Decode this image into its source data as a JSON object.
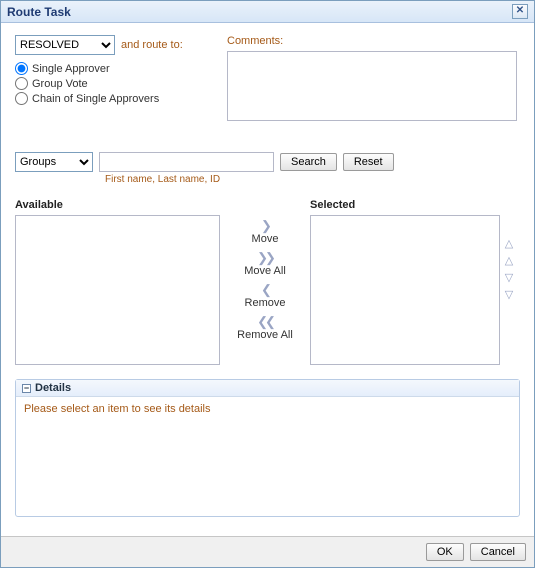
{
  "title": "Route Task",
  "status": {
    "options": [
      "RESOLVED"
    ],
    "selected": "RESOLVED"
  },
  "route_to_label": "and route to:",
  "route_type": {
    "single": "Single Approver",
    "group": "Group Vote",
    "chain": "Chain of Single Approvers",
    "selected": "single"
  },
  "comments_label": "Comments:",
  "comments_value": "",
  "scope": {
    "options": [
      "Groups"
    ],
    "selected": "Groups"
  },
  "search_value": "",
  "search_btn": "Search",
  "reset_btn": "Reset",
  "name_hint": "First name, Last name, ID",
  "available_label": "Available",
  "selected_label": "Selected",
  "move": {
    "move": "Move",
    "moveall": "Move All",
    "remove": "Remove",
    "removeall": "Remove All"
  },
  "details": {
    "title": "Details",
    "empty": "Please select an item to see its details"
  },
  "ok": "OK",
  "cancel": "Cancel"
}
